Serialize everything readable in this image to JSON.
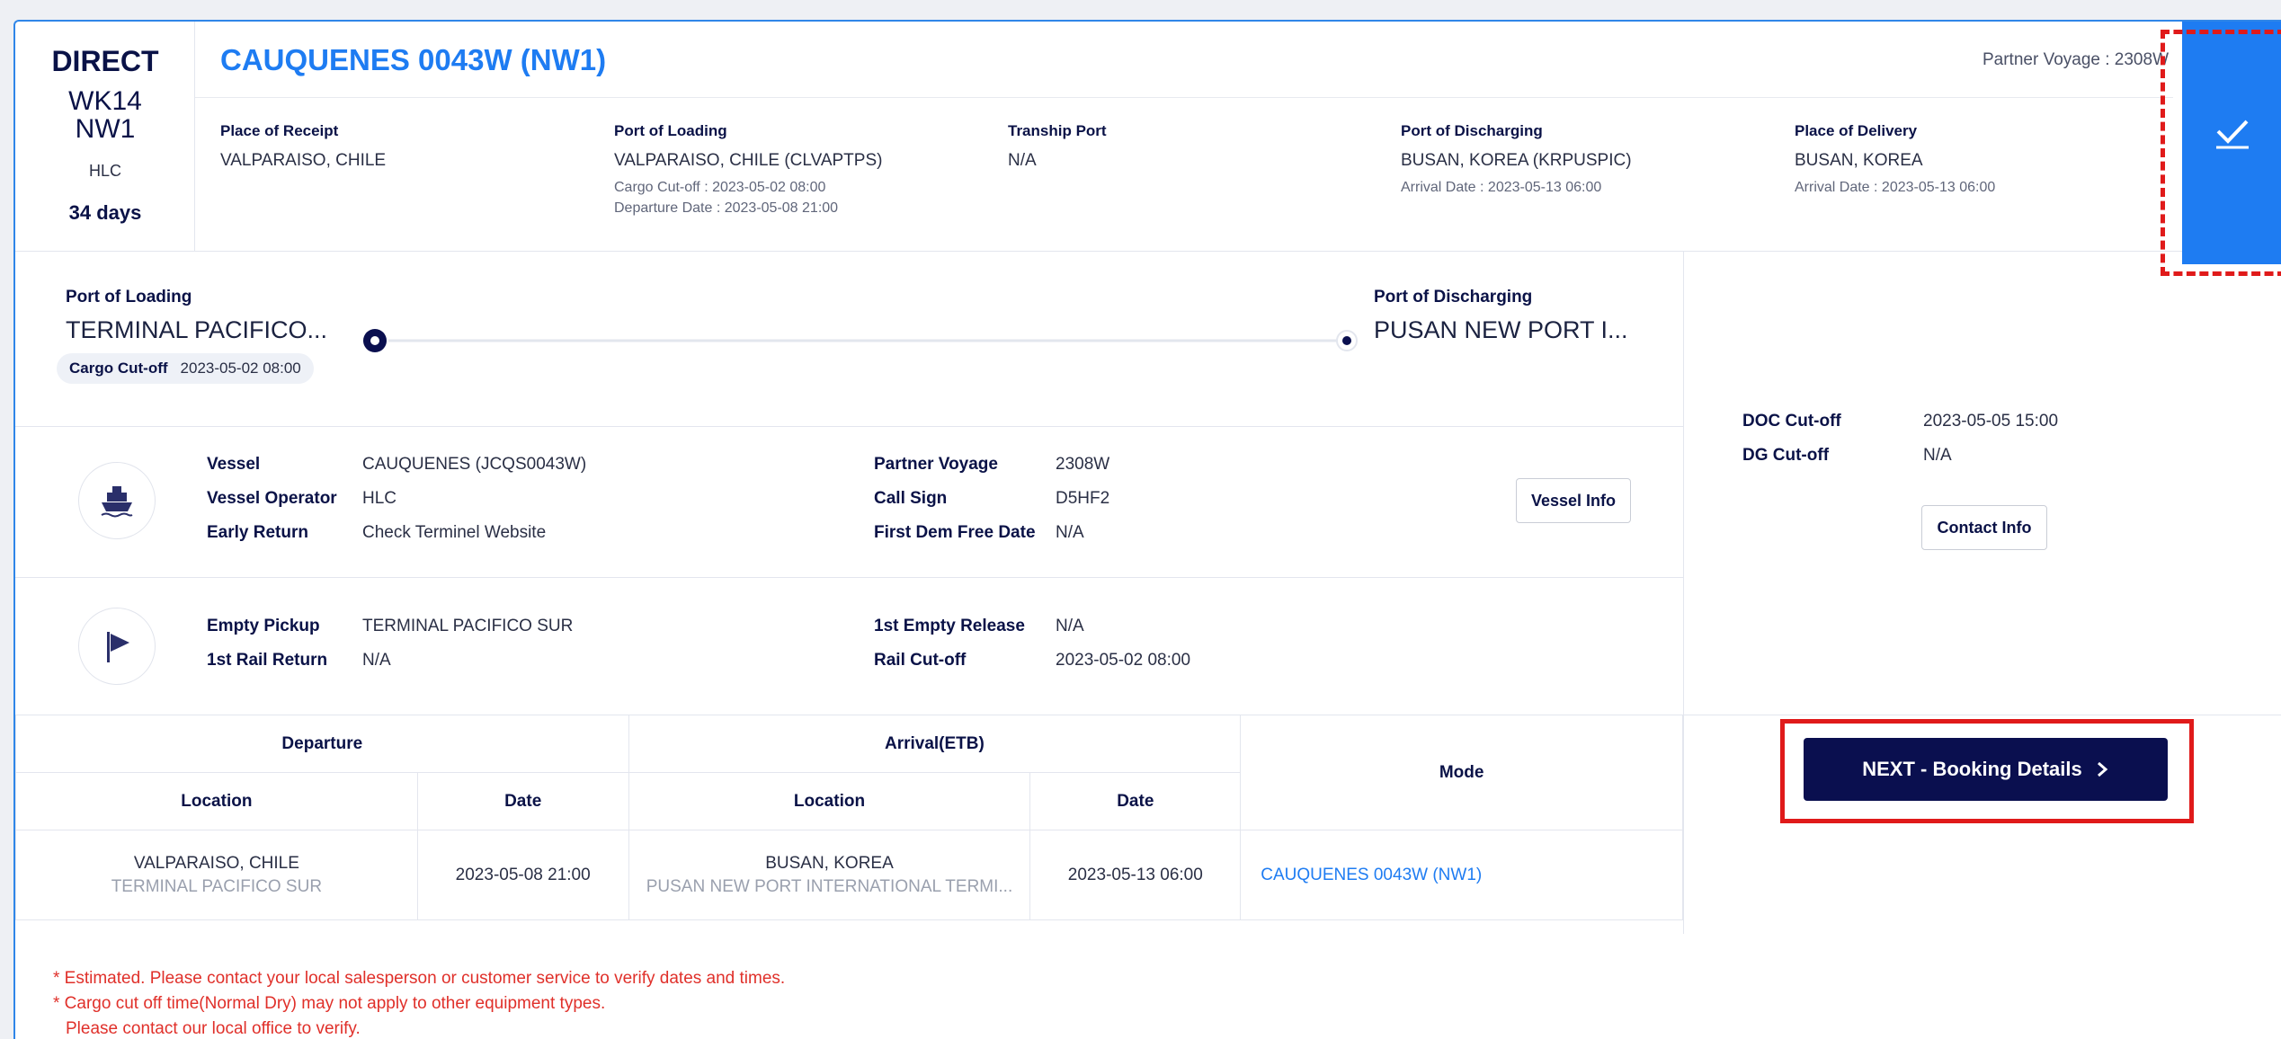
{
  "header": {
    "service_type": "DIRECT",
    "week": "WK14",
    "service": "NW1",
    "carrier": "HLC",
    "transit_days": "34 days",
    "vessel_title": "CAUQUENES 0043W (NW1)",
    "partner_voyage": "Partner Voyage : 2308W"
  },
  "route": {
    "place_of_receipt": {
      "label": "Place of Receipt",
      "value": "VALPARAISO, CHILE"
    },
    "port_of_loading": {
      "label": "Port of Loading",
      "value": "VALPARAISO, CHILE (CLVAPTPS)",
      "cargo_cutoff": "Cargo Cut-off : 2023-05-02 08:00",
      "departure": "Departure Date : 2023-05-08 21:00"
    },
    "tranship_port": {
      "label": "Tranship Port",
      "value": "N/A"
    },
    "port_of_discharging": {
      "label": "Port of Discharging",
      "value": "BUSAN, KOREA (KRPUSPIC)",
      "arrival": "Arrival Date : 2023-05-13 06:00"
    },
    "place_of_delivery": {
      "label": "Place of Delivery",
      "value": "BUSAN, KOREA",
      "arrival": "Arrival Date : 2023-05-13 06:00"
    }
  },
  "timeline": {
    "pol_label": "Port of Loading",
    "pol_terminal": "TERMINAL PACIFICO...",
    "cutoff_label": "Cargo Cut-off",
    "cutoff_value": "2023-05-02 08:00",
    "pod_label": "Port of Discharging",
    "pod_terminal": "PUSAN NEW PORT I..."
  },
  "vessel": {
    "vessel_label": "Vessel",
    "vessel_value": "CAUQUENES (JCQS0043W)",
    "operator_label": "Vessel Operator",
    "operator_value": "HLC",
    "early_return_label": "Early Return",
    "early_return_value": "Check Terminel Website",
    "partner_voyage_label": "Partner Voyage",
    "partner_voyage_value": "2308W",
    "call_sign_label": "Call Sign",
    "call_sign_value": "D5HF2",
    "first_dem_label": "First Dem Free Date",
    "first_dem_value": "N/A",
    "vessel_info_button": "Vessel Info"
  },
  "empty": {
    "pickup_label": "Empty Pickup",
    "pickup_value": "TERMINAL PACIFICO SUR",
    "rail_return_label": "1st Rail Return",
    "rail_return_value": "N/A",
    "release_label": "1st Empty Release",
    "release_value": "N/A",
    "rail_cutoff_label": "Rail Cut-off",
    "rail_cutoff_value": "2023-05-02 08:00"
  },
  "cutoffs": {
    "doc_label": "DOC Cut-off",
    "doc_value": "2023-05-05 15:00",
    "dg_label": "DG Cut-off",
    "dg_value": "N/A",
    "contact_button": "Contact Info"
  },
  "schedule": {
    "departure_header": "Departure",
    "arrival_header": "Arrival(ETB)",
    "mode_header": "Mode",
    "location_header": "Location",
    "date_header": "Date",
    "dep_location": "VALPARAISO, CHILE",
    "dep_terminal": "TERMINAL PACIFICO SUR",
    "dep_date": "2023-05-08 21:00",
    "arr_location": "BUSAN, KOREA",
    "arr_terminal": "PUSAN NEW PORT INTERNATIONAL TERMI...",
    "arr_date": "2023-05-13 06:00",
    "mode": "CAUQUENES 0043W (NW1)"
  },
  "next_button": "NEXT - Booking Details",
  "notes": {
    "line1": "* Estimated. Please contact your local salesperson or customer service to verify dates and times.",
    "line2": "* Cargo cut off time(Normal Dry) may not apply to other equipment types.",
    "line3": "Please contact our local office to verify."
  },
  "colors": {
    "accent": "#1e7cf2",
    "navy": "#0a0f4f",
    "highlight": "#e01a1a"
  }
}
